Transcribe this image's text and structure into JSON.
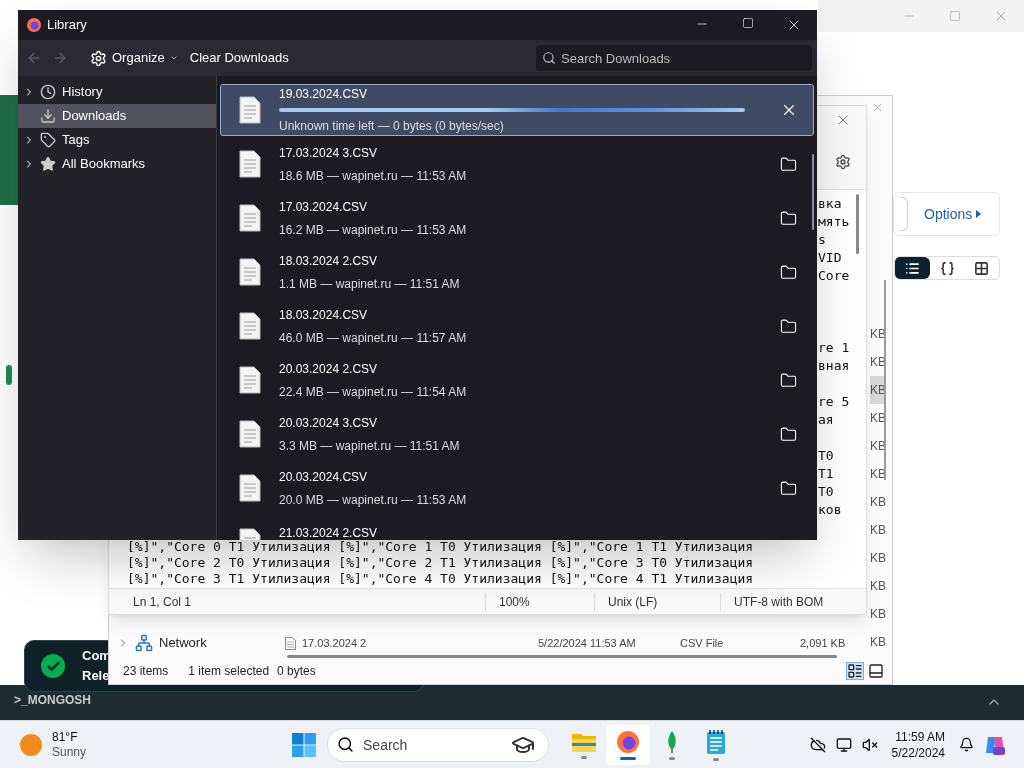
{
  "background_app": {
    "options_button": "Options",
    "view_toggle": [
      {
        "kind": "list",
        "selected": true
      },
      {
        "kind": "json",
        "selected": false
      },
      {
        "kind": "table",
        "selected": false
      }
    ],
    "shell_bar": {
      "label": ">_MONGOSH"
    },
    "toast": {
      "lines": [
        "Com",
        "Rele"
      ]
    }
  },
  "explorer": {
    "nav_items": [
      {
        "label": "Network",
        "expanded": false
      }
    ],
    "size_column": [
      {
        "text": "KB",
        "selected": false
      },
      {
        "text": "KB",
        "selected": false
      },
      {
        "text": "KB",
        "selected": true
      },
      {
        "text": "KB",
        "selected": false
      },
      {
        "text": "KB",
        "selected": false
      },
      {
        "text": "KB",
        "selected": false
      },
      {
        "text": "KB",
        "selected": false
      },
      {
        "text": "KB",
        "selected": false
      },
      {
        "text": "KB",
        "selected": false
      },
      {
        "text": "KB",
        "selected": false
      },
      {
        "text": "KB",
        "selected": false
      },
      {
        "text": "KB",
        "selected": false
      }
    ],
    "files": [
      {
        "name": "17.03.2024 2",
        "date": "5/22/2024 11:53 AM",
        "type": "CSV File",
        "size": "2,091 KB"
      }
    ],
    "status_bar": {
      "count": "23 items",
      "selection": "1 item selected",
      "size": "0 bytes"
    }
  },
  "notepad": {
    "right_fragments": [
      [
        "вка",
        "мять",
        "s",
        "VID",
        "Core"
      ],
      [
        "re 1",
        "вная"
      ],
      [
        "re 5",
        "ая"
      ],
      [
        "T0",
        "T1",
        "T0",
        "ков"
      ]
    ],
    "lines": [
      "[%]\",\"Core 0 T1 Утилизация [%]\",\"Core 1 T0 Утилизация [%]\",\"Core 1 T1 Утилизация",
      "[%]\",\"Core 2 T0 Утилизация [%]\",\"Core 2 T1 Утилизация [%]\",\"Core 3 T0 Утилизация",
      "[%]\",\"Core 3 T1 Утилизация [%]\",\"Core 4 T0 Утилизация [%]\",\"Core 4 T1 Утилизация"
    ],
    "status_bar": [
      "Ln 1, Col 1",
      "100%",
      "Unix (LF)",
      "UTF-8 with BOM"
    ]
  },
  "library": {
    "title": "Library",
    "toolbar": {
      "organize": "Organize",
      "clear": "Clear Downloads",
      "search_placeholder": "Search Downloads"
    },
    "sidebar": [
      {
        "label": "History",
        "kind": "history",
        "expanded": false,
        "selected": false
      },
      {
        "label": "Downloads",
        "kind": "downloads",
        "selected": true
      },
      {
        "label": "Tags",
        "kind": "tags",
        "expanded": false,
        "selected": false
      },
      {
        "label": "All Bookmarks",
        "kind": "bookmarks",
        "expanded": false,
        "selected": false
      }
    ],
    "downloads": [
      {
        "name": "19.03.2024.CSV",
        "status": "Unknown time left — 0 bytes (0 bytes/sec)",
        "kind": "in-progress",
        "selected": true
      },
      {
        "name": "17.03.2024 3.CSV",
        "status": "18.6 MB — wapinet.ru — 11:53 AM",
        "kind": "done",
        "selected": false
      },
      {
        "name": "17.03.2024.CSV",
        "status": "16.2 MB — wapinet.ru — 11:53 AM",
        "kind": "done",
        "selected": false
      },
      {
        "name": "18.03.2024 2.CSV",
        "status": "1.1 MB — wapinet.ru — 11:51 AM",
        "kind": "done",
        "selected": false
      },
      {
        "name": "18.03.2024.CSV",
        "status": "46.0 MB — wapinet.ru — 11:57 AM",
        "kind": "done",
        "selected": false
      },
      {
        "name": "20.03.2024 2.CSV",
        "status": "22.4 MB — wapinet.ru — 11:54 AM",
        "kind": "done",
        "selected": false
      },
      {
        "name": "20.03.2024 3.CSV",
        "status": "3.3 MB — wapinet.ru — 11:51 AM",
        "kind": "done",
        "selected": false
      },
      {
        "name": "20.03.2024.CSV",
        "status": "20.0 MB — wapinet.ru — 11:53 AM",
        "kind": "done",
        "selected": false
      },
      {
        "name": "21.03.2024 2.CSV",
        "kind": "partial",
        "selected": false
      }
    ]
  },
  "taskbar": {
    "weather": {
      "temp": "81°F",
      "condition": "Sunny"
    },
    "search_placeholder": "Search",
    "apps": [
      {
        "kind": "explorer",
        "active": false
      },
      {
        "kind": "firefox",
        "active": true
      },
      {
        "kind": "mongodb",
        "active": false
      },
      {
        "kind": "notepad",
        "active": false
      }
    ],
    "clock": {
      "time": "11:59 AM",
      "date": "5/22/2024"
    }
  }
}
